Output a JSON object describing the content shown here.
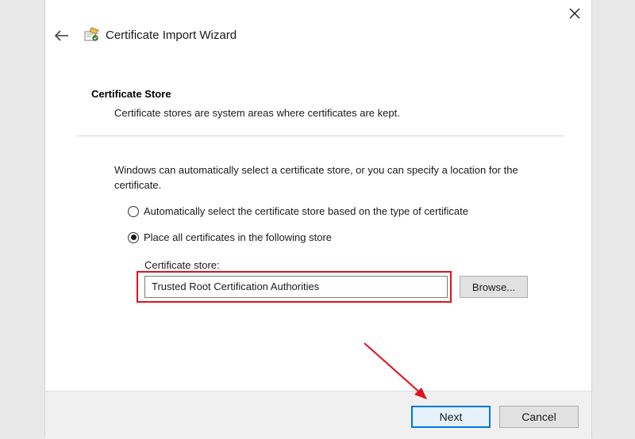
{
  "window": {
    "title": "Certificate Import Wizard"
  },
  "section": {
    "heading": "Certificate Store",
    "description": "Certificate stores are system areas where certificates are kept."
  },
  "intro": "Windows can automatically select a certificate store, or you can specify a location for the certificate.",
  "options": [
    {
      "label": "Automatically select the certificate store based on the type of certificate",
      "selected": false
    },
    {
      "label": "Place all certificates in the following store",
      "selected": true
    }
  ],
  "store": {
    "label": "Certificate store:",
    "value": "Trusted Root Certification Authorities",
    "browse_label": "Browse..."
  },
  "footer": {
    "next_label": "Next",
    "cancel_label": "Cancel"
  },
  "colors": {
    "annotation": "#e0131c",
    "accent": "#0078d7"
  },
  "icons": {
    "back": "back-arrow-icon",
    "close": "close-icon",
    "wizard": "certificate-wizard-icon"
  }
}
